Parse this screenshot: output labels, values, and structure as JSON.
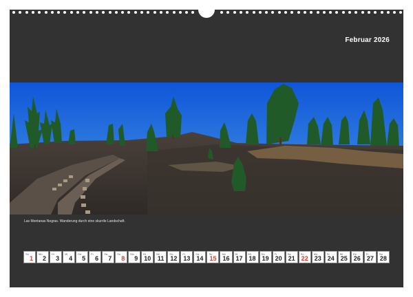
{
  "header": {
    "title": "Februar 2026"
  },
  "caption": "Las Montanas Negras. Wanderung durch eine skurrile Landschaft.",
  "calendar": {
    "days": [
      {
        "dn": "So",
        "num": "1",
        "sun": true
      },
      {
        "dn": "Mo",
        "num": "2"
      },
      {
        "dn": "Di",
        "num": "3"
      },
      {
        "dn": "Mi",
        "num": "4"
      },
      {
        "dn": "Do",
        "num": "5"
      },
      {
        "dn": "Fr",
        "num": "6"
      },
      {
        "dn": "Sa",
        "num": "7"
      },
      {
        "dn": "So",
        "num": "8",
        "sun": true
      },
      {
        "dn": "Mo",
        "num": "9"
      },
      {
        "dn": "Di",
        "num": "10"
      },
      {
        "dn": "Mi",
        "num": "11"
      },
      {
        "dn": "Do",
        "num": "12"
      },
      {
        "dn": "Fr",
        "num": "13"
      },
      {
        "dn": "Sa",
        "num": "14"
      },
      {
        "dn": "So",
        "num": "15",
        "sun": true
      },
      {
        "dn": "Mo",
        "num": "16"
      },
      {
        "dn": "Di",
        "num": "17"
      },
      {
        "dn": "Mi",
        "num": "18"
      },
      {
        "dn": "Do",
        "num": "19"
      },
      {
        "dn": "Fr",
        "num": "20"
      },
      {
        "dn": "Sa",
        "num": "21"
      },
      {
        "dn": "So",
        "num": "22",
        "sun": true
      },
      {
        "dn": "Mo",
        "num": "23"
      },
      {
        "dn": "Di",
        "num": "24"
      },
      {
        "dn": "Mi",
        "num": "25"
      },
      {
        "dn": "Do",
        "num": "26"
      },
      {
        "dn": "Fr",
        "num": "27"
      },
      {
        "dn": "Sa",
        "num": "28"
      }
    ]
  },
  "colors": {
    "page_bg": "#323232",
    "sunday": "#e03b2a",
    "sky": "#1d6fe0"
  }
}
